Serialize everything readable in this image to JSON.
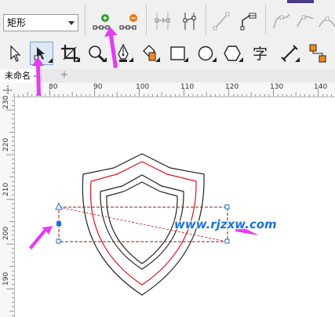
{
  "toolbar1": {
    "shape_select": {
      "value": "矩形"
    },
    "buttons": [
      {
        "name": "add-node-button",
        "icon": "add-node-icon"
      },
      {
        "name": "delete-node-button",
        "icon": "delete-node-icon"
      },
      {
        "name": "join-nodes-button",
        "icon": "join-nodes-icon"
      },
      {
        "name": "break-node-button",
        "icon": "break-node-icon"
      },
      {
        "name": "to-line-button",
        "icon": "to-line-icon"
      },
      {
        "name": "to-curve-button",
        "icon": "to-curve-icon"
      },
      {
        "name": "cusp-node-button",
        "icon": "cusp-node-icon"
      },
      {
        "name": "smooth-node-button",
        "icon": "smooth-node-icon"
      },
      {
        "name": "symmetric-node-button",
        "icon": "symmetric-node-icon"
      }
    ]
  },
  "toolbox": {
    "tools": [
      {
        "name": "pick-tool",
        "icon": "arrow-pointer-icon"
      },
      {
        "name": "shape-tool",
        "icon": "shape-tool-icon",
        "active": true
      },
      {
        "name": "crop-tool",
        "icon": "crop-icon"
      },
      {
        "name": "zoom-tool",
        "icon": "magnifier-icon"
      },
      {
        "name": "pen-tool",
        "icon": "pen-nib-icon"
      },
      {
        "name": "fill-tool",
        "icon": "paint-bucket-icon"
      },
      {
        "name": "rectangle-tool",
        "icon": "rectangle-icon"
      },
      {
        "name": "ellipse-tool",
        "icon": "ellipse-icon"
      },
      {
        "name": "polygon-tool",
        "icon": "hexagon-icon"
      },
      {
        "name": "text-tool",
        "icon": "text-icon",
        "label": "字"
      },
      {
        "name": "dimension-tool",
        "icon": "dimension-line-icon"
      },
      {
        "name": "connector-tool",
        "icon": "connector-icon"
      }
    ]
  },
  "document_tab": {
    "label": "未命名 -",
    "add_label": "+"
  },
  "ruler_h": {
    "ticks": [
      "80",
      "90",
      "100",
      "110",
      "120",
      "130",
      "140"
    ]
  },
  "ruler_v": {
    "ticks": [
      "230",
      "220",
      "210",
      "200",
      "190"
    ]
  },
  "watermark": {
    "text": "www.rjzxw.com"
  },
  "colors": {
    "accent_arrow": "#e43cf0",
    "outline_red": "#e0101c",
    "outline_black": "#222222",
    "node_blue": "#1c6fd6",
    "watermark_blue": "#1e74d8"
  }
}
